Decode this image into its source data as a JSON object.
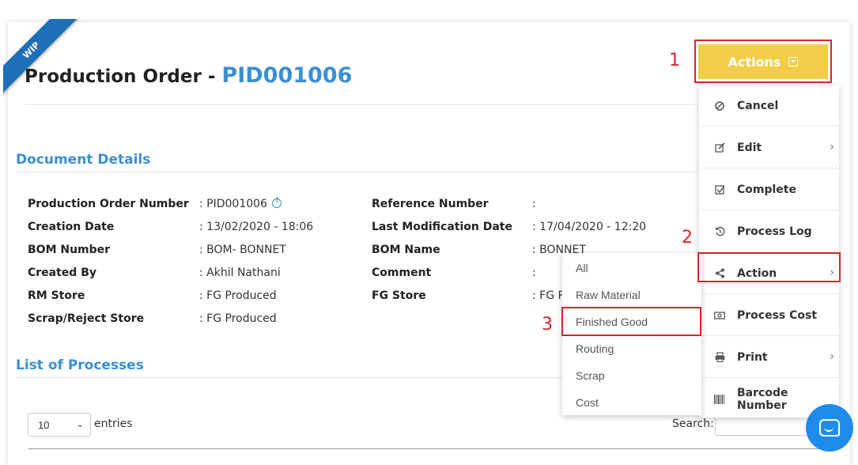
{
  "ribbon": "WIP",
  "header": {
    "title_prefix": "Production Order - ",
    "order_id": "PID001006"
  },
  "actions": {
    "label": "Actions"
  },
  "annotations": [
    "1",
    "2",
    "3"
  ],
  "sections": {
    "document_details": "Document Details",
    "list_of_processes": "List of Processes"
  },
  "details_left": [
    {
      "label": "Production Order Number",
      "value": ": PID001006"
    },
    {
      "label": "Creation Date",
      "value": ": 13/02/2020 - 18:06"
    },
    {
      "label": "BOM Number",
      "value": ": BOM- BONNET"
    },
    {
      "label": "Created By",
      "value": ": Akhil Nathani"
    },
    {
      "label": "RM Store",
      "value": ": FG Produced"
    },
    {
      "label": "Scrap/Reject Store",
      "value": ": FG Produced"
    }
  ],
  "details_right": [
    {
      "label": "Reference Number",
      "value": ":"
    },
    {
      "label": "Last Modification Date",
      "value": ": 17/04/2020 - 12:20"
    },
    {
      "label": "BOM Name",
      "value": ": BONNET"
    },
    {
      "label": "Comment",
      "value": ":"
    },
    {
      "label": "FG Store",
      "value": ": FG P"
    }
  ],
  "menu": [
    {
      "label": "Cancel",
      "icon": "ban-icon",
      "submenu": false
    },
    {
      "label": "Edit",
      "icon": "edit-icon",
      "submenu": true
    },
    {
      "label": "Complete",
      "icon": "check-square-icon",
      "submenu": false
    },
    {
      "label": "Process Log",
      "icon": "history-icon",
      "submenu": false
    },
    {
      "label": "Action",
      "icon": "share-icon",
      "submenu": true
    },
    {
      "label": "Process Cost",
      "icon": "money-icon",
      "submenu": false
    },
    {
      "label": "Print",
      "icon": "print-icon",
      "submenu": true
    },
    {
      "label": "Barcode Number",
      "icon": "barcode-icon",
      "submenu": false
    }
  ],
  "submenu": [
    "All",
    "Raw Material",
    "Finished Good",
    "Routing",
    "Scrap",
    "Cost"
  ],
  "table_controls": {
    "entries_value": "10",
    "entries_label": "entries",
    "search_label": "Search:"
  },
  "colors": {
    "accent_blue": "#3a8fd6",
    "actions_yellow": "#f2cd47",
    "annotation_red": "#d9252b",
    "ribbon_blue": "#1e6fb8",
    "chat_blue": "#1f8ceb"
  }
}
